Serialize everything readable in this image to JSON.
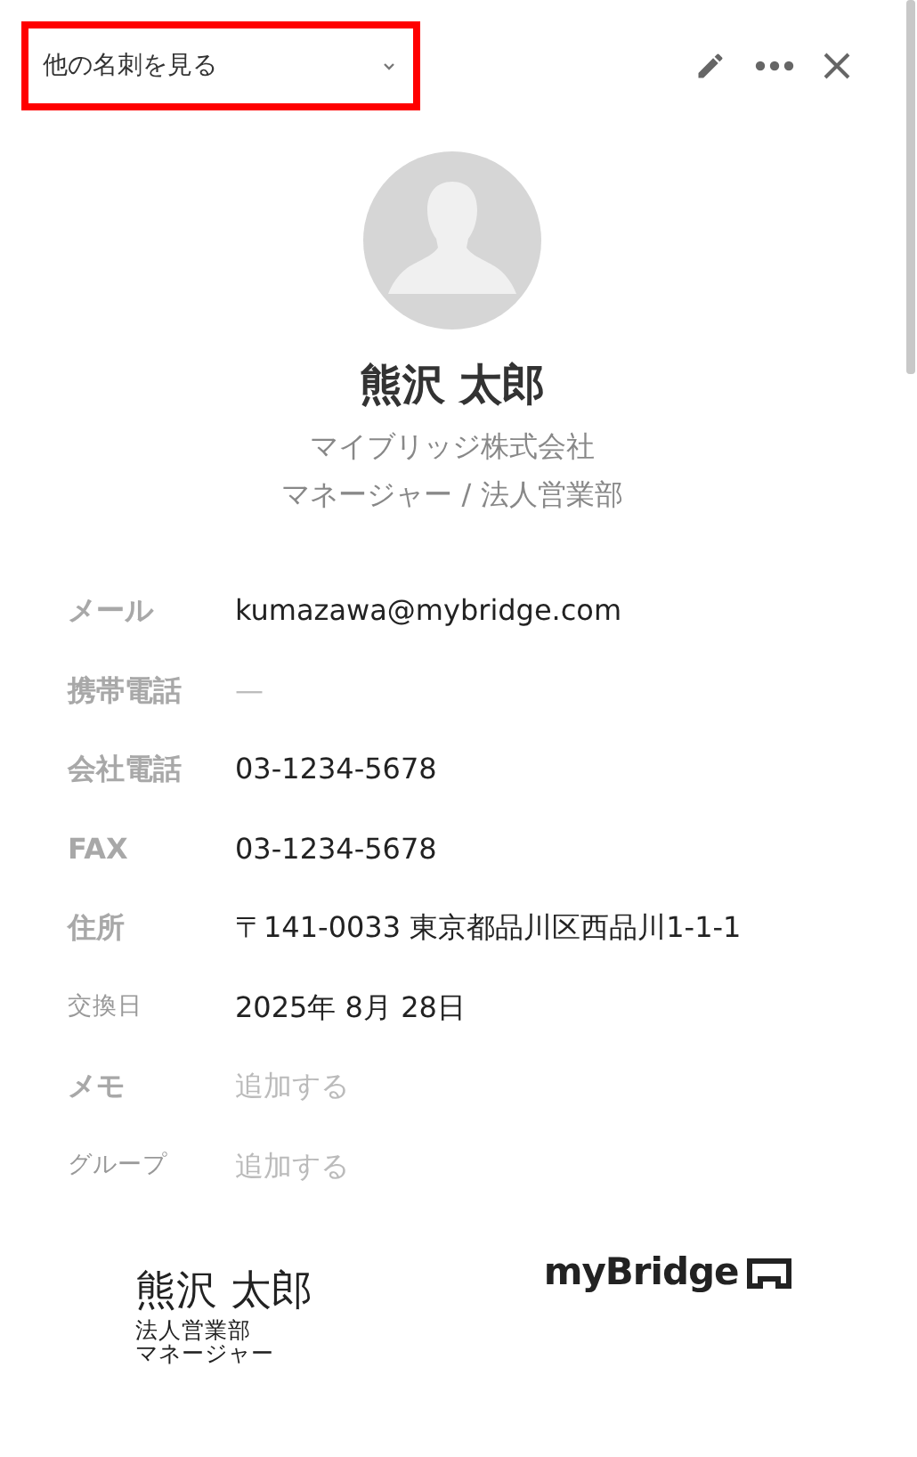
{
  "header": {
    "dropdown": {
      "label": "他の名刺を見る",
      "highlighted": true
    }
  },
  "profile": {
    "name": "熊沢 太郎",
    "company": "マイブリッジ株式会社",
    "title": "マネージャー / 法人営業部"
  },
  "fields": [
    {
      "label": "メール",
      "kind": "main",
      "value": "kumazawa@mybridge.com",
      "muted": false
    },
    {
      "label": "携帯電話",
      "kind": "main",
      "value": "—",
      "muted": true
    },
    {
      "label": "会社電話",
      "kind": "main",
      "value": "03-1234-5678",
      "muted": false
    },
    {
      "label": "FAX",
      "kind": "main",
      "value": "03-1234-5678",
      "muted": false
    },
    {
      "label": "住所",
      "kind": "main",
      "value": "〒141-0033 東京都品川区西品川1-1-1",
      "muted": false
    },
    {
      "label": "交換日",
      "kind": "minor",
      "value": "2025年 8月 28日",
      "muted": false
    },
    {
      "label": "メモ",
      "kind": "main",
      "value": "追加する",
      "muted": true
    },
    {
      "label": "グループ",
      "kind": "minor",
      "value": "追加する",
      "muted": true
    }
  ],
  "card_preview": {
    "name": "熊沢 太郎",
    "department": "法人営業部",
    "title": "マネージャー",
    "logo": "myBridge"
  }
}
